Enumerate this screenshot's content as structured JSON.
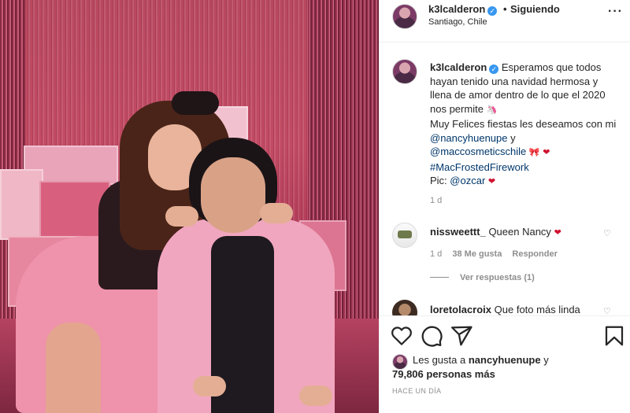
{
  "post": {
    "username": "k3lcalderon",
    "follow_sep": "•",
    "follow_label": "Siguiendo",
    "location": "Santiago, Chile",
    "more_label": "···"
  },
  "caption": {
    "username": "k3lcalderon",
    "text_1": "Esperamos que todos hayan tenido una navidad hermosa y llena de amor dentro de lo que el 2020 nos permite",
    "text_2": "Muy Felices fiestas les deseamos con mi",
    "mention_1": "@nancyhuenupe",
    "conj": "y",
    "mention_2": "@maccosmeticschile",
    "hashtag": "#MacFrostedFirework",
    "pic_label": "Pic:",
    "mention_3": "@ozcar",
    "time": "1 d"
  },
  "comments": [
    {
      "username": "nissweettt_",
      "text": "Queen Nancy",
      "time": "1 d",
      "likes": "38 Me gusta",
      "reply_label": "Responder",
      "view_replies": "Ver respuestas (1)"
    },
    {
      "username": "loretolacroix",
      "text": "Que foto más linda"
    }
  ],
  "likes": {
    "line_1_prefix": "Les gusta a",
    "liker": "nancyhuenupe",
    "conj": "y",
    "count": "79,806 personas más"
  },
  "date": "HACE UN DÍA",
  "icons": {
    "verified": "verified-badge-icon",
    "more": "more-options-icon",
    "heart": "heart-icon",
    "comment": "comment-icon",
    "share": "share-icon",
    "save": "bookmark-icon"
  },
  "colors": {
    "link": "#00376b",
    "verified": "#3897f0",
    "heart_red": "#d0102f",
    "muted": "#8e8e8e"
  }
}
